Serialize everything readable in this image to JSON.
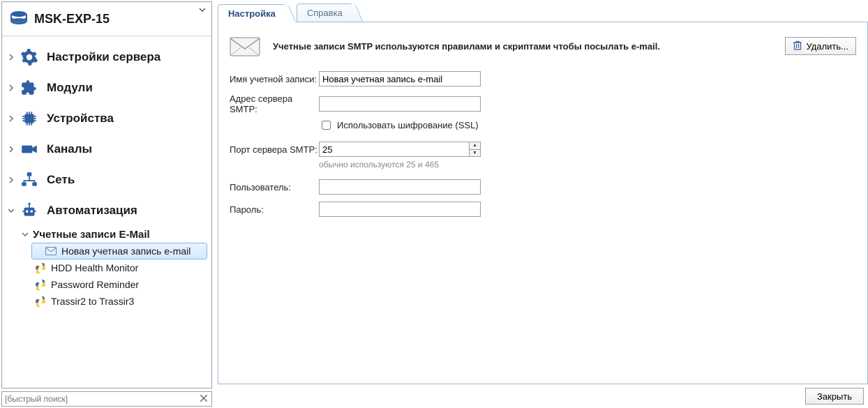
{
  "server": {
    "name": "MSK-EXP-15"
  },
  "sidebar": {
    "items": [
      {
        "label": "Настройки сервера"
      },
      {
        "label": "Модули"
      },
      {
        "label": "Устройства"
      },
      {
        "label": "Каналы"
      },
      {
        "label": "Сеть"
      },
      {
        "label": "Автоматизация"
      }
    ],
    "automation": {
      "email_group": "Учетные записи E-Mail",
      "email_item": "Новая учетная запись e-mail",
      "scripts": [
        "HDD Health Monitor",
        "Password Reminder",
        "Trassir2 to Trassir3"
      ]
    },
    "quick_search_placeholder": "[быстрый поиск]"
  },
  "tabs": {
    "settings": "Настройка",
    "help": "Справка"
  },
  "panel": {
    "info": "Учетные записи SMTP используются правилами и скриптами чтобы посылать e-mail.",
    "delete": "Удалить...",
    "labels": {
      "account": "Имя учетной записи:",
      "smtp": "Адрес сервера SMTP:",
      "ssl": "Использовать шифрование (SSL)",
      "port": "Порт сервера SMTP:",
      "port_hint": "обычно используются 25 и 465",
      "user": "Пользователь:",
      "pass": "Пароль:"
    },
    "values": {
      "account": "Новая учетная запись e-mail",
      "smtp": "",
      "ssl": false,
      "port": "25",
      "user": "",
      "pass": ""
    }
  },
  "footer": {
    "close": "Закрыть"
  }
}
